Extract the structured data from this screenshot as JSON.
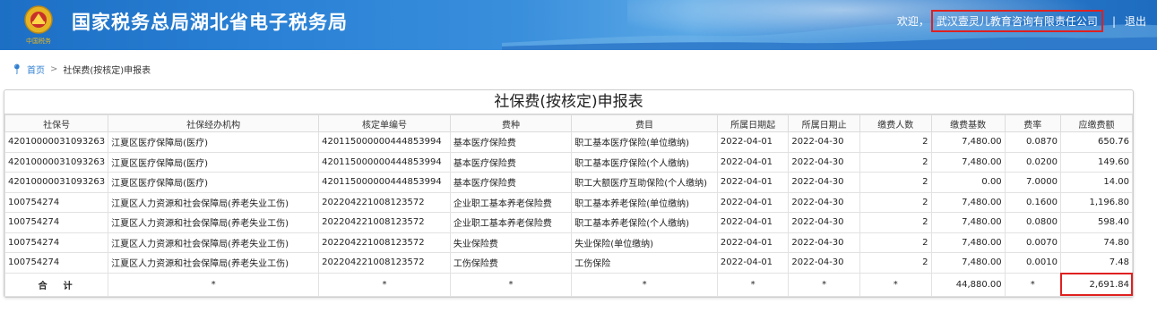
{
  "header": {
    "title": "国家税务总局湖北省电子税务局",
    "welcome": "欢迎，",
    "company": "武汉壹灵儿教育咨询有限责任公司",
    "separator": "|",
    "logout": "退出",
    "emblem_text": "中国税务"
  },
  "breadcrumb": {
    "home": "首页",
    "arrow": ">",
    "current": "社保费(按核定)申报表"
  },
  "panel": {
    "title": "社保费(按核定)申报表"
  },
  "table": {
    "columns": [
      "社保号",
      "社保经办机构",
      "核定单编号",
      "费种",
      "费目",
      "所属日期起",
      "所属日期止",
      "缴费人数",
      "缴费基数",
      "费率",
      "应缴费额"
    ],
    "rows": [
      [
        "42010000031093263",
        "江夏区医疗保障局(医疗)",
        "420115000000444853994",
        "基本医疗保险费",
        "职工基本医疗保险(单位缴纳)",
        "2022-04-01",
        "2022-04-30",
        "2",
        "7,480.00",
        "0.0870",
        "650.76"
      ],
      [
        "42010000031093263",
        "江夏区医疗保障局(医疗)",
        "420115000000444853994",
        "基本医疗保险费",
        "职工基本医疗保险(个人缴纳)",
        "2022-04-01",
        "2022-04-30",
        "2",
        "7,480.00",
        "0.0200",
        "149.60"
      ],
      [
        "42010000031093263",
        "江夏区医疗保障局(医疗)",
        "420115000000444853994",
        "基本医疗保险费",
        "职工大额医疗互助保险(个人缴纳)",
        "2022-04-01",
        "2022-04-30",
        "2",
        "0.00",
        "7.0000",
        "14.00"
      ],
      [
        "100754274",
        "江夏区人力资源和社会保障局(养老失业工伤)",
        "202204221008123572",
        "企业职工基本养老保险费",
        "职工基本养老保险(单位缴纳)",
        "2022-04-01",
        "2022-04-30",
        "2",
        "7,480.00",
        "0.1600",
        "1,196.80"
      ],
      [
        "100754274",
        "江夏区人力资源和社会保障局(养老失业工伤)",
        "202204221008123572",
        "企业职工基本养老保险费",
        "职工基本养老保险(个人缴纳)",
        "2022-04-01",
        "2022-04-30",
        "2",
        "7,480.00",
        "0.0800",
        "598.40"
      ],
      [
        "100754274",
        "江夏区人力资源和社会保障局(养老失业工伤)",
        "202204221008123572",
        "失业保险费",
        "失业保险(单位缴纳)",
        "2022-04-01",
        "2022-04-30",
        "2",
        "7,480.00",
        "0.0070",
        "74.80"
      ],
      [
        "100754274",
        "江夏区人力资源和社会保障局(养老失业工伤)",
        "202204221008123572",
        "工伤保险费",
        "工伤保险",
        "2022-04-01",
        "2022-04-30",
        "2",
        "7,480.00",
        "0.0010",
        "7.48"
      ]
    ],
    "total": {
      "label": "合计",
      "star": "*",
      "base_total": "44,880.00",
      "amount_total": "2,691.84"
    }
  },
  "colors": {
    "header_blue": "#2b82d6",
    "link_blue": "#2f7fd0",
    "highlight_red": "#e02020"
  }
}
